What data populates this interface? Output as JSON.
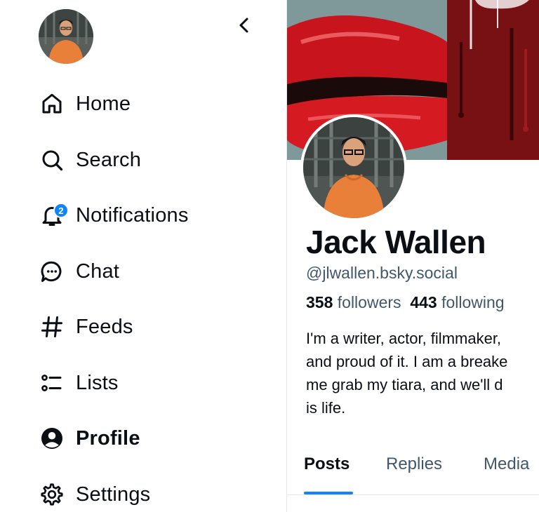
{
  "sidebar": {
    "items": [
      {
        "label": "Home",
        "icon": "home-icon"
      },
      {
        "label": "Search",
        "icon": "search-icon"
      },
      {
        "label": "Notifications",
        "icon": "bell-icon",
        "badge": "2"
      },
      {
        "label": "Chat",
        "icon": "chat-icon"
      },
      {
        "label": "Feeds",
        "icon": "hash-icon"
      },
      {
        "label": "Lists",
        "icon": "list-icon"
      },
      {
        "label": "Profile",
        "icon": "user-circle-icon",
        "active": true
      },
      {
        "label": "Settings",
        "icon": "gear-icon"
      }
    ]
  },
  "profile": {
    "display_name": "Jack Wallen",
    "handle": "@jlwallen.bsky.social",
    "followers_count": "358",
    "followers_label": "followers",
    "following_count": "443",
    "following_label": "following",
    "bio_lines": [
      "I'm a writer, actor, filmmaker,",
      "and proud of it. I am a breake",
      "me grab my tiara, and we'll d",
      "is life."
    ],
    "tabs": [
      "Posts",
      "Replies",
      "Media"
    ],
    "active_tab": "Posts"
  },
  "colors": {
    "accent": "#1083fe",
    "muted_text": "#42576c",
    "text": "#0b0f14",
    "avatar_shirt": "#e8803a"
  }
}
